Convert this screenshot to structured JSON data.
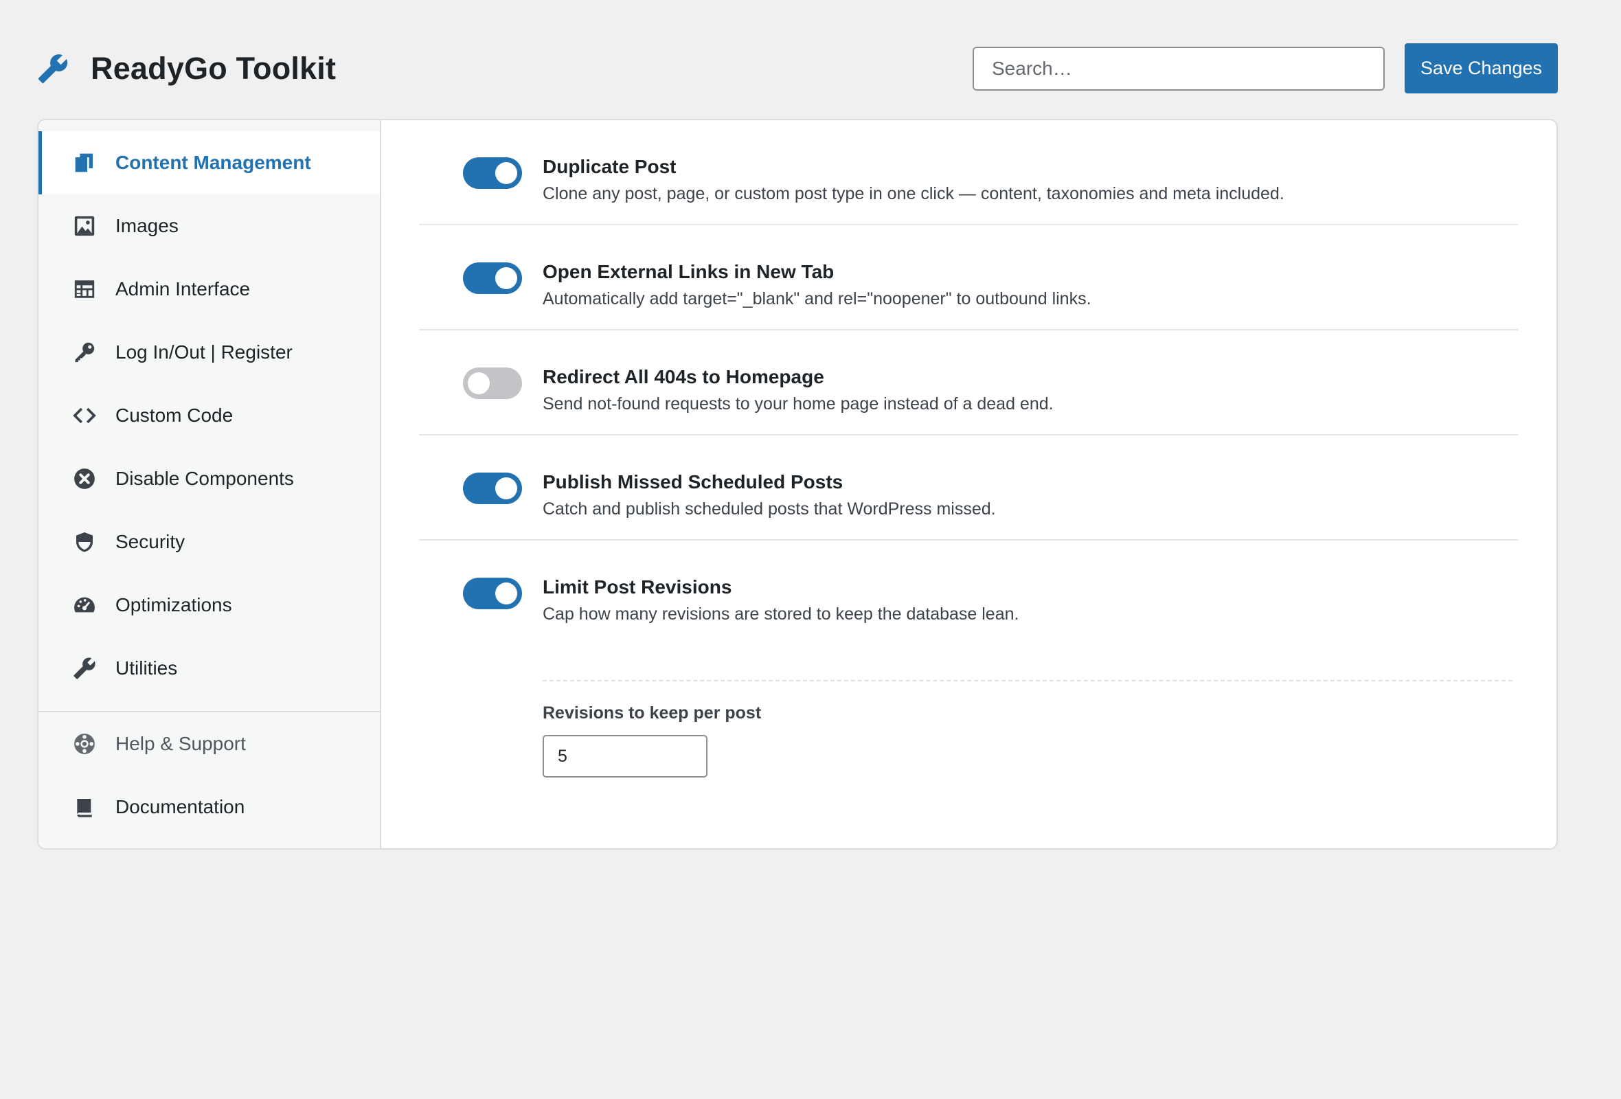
{
  "header": {
    "title": "ReadyGo Toolkit",
    "search_placeholder": "Search…",
    "save_label": "Save Changes"
  },
  "sidebar": {
    "items": [
      {
        "label": "Content Management",
        "icon": "copy-icon",
        "active": true
      },
      {
        "label": "Images",
        "icon": "image-icon"
      },
      {
        "label": "Admin Interface",
        "icon": "table-icon"
      },
      {
        "label": "Log In/Out | Register",
        "icon": "key-icon"
      },
      {
        "label": "Custom Code",
        "icon": "code-icon"
      },
      {
        "label": "Disable Components",
        "icon": "x-circle-icon"
      },
      {
        "label": "Security",
        "icon": "shield-icon"
      },
      {
        "label": "Optimizations",
        "icon": "dashboard-icon"
      },
      {
        "label": "Utilities",
        "icon": "wrench-icon"
      }
    ],
    "secondary": [
      {
        "label": "Help & Support",
        "icon": "lifebuoy-icon"
      },
      {
        "label": "Documentation",
        "icon": "book-icon"
      }
    ]
  },
  "settings": [
    {
      "title": "Duplicate Post",
      "description": "Clone any post, page, or custom post type in one click — content, taxonomies and meta included.",
      "enabled": true
    },
    {
      "title": "Open External Links in New Tab",
      "description": "Automatically add target=\"_blank\" and rel=\"noopener\" to outbound links.",
      "enabled": true
    },
    {
      "title": "Redirect All 404s to Homepage",
      "description": "Send not-found requests to your home page instead of a dead end.",
      "enabled": false
    },
    {
      "title": "Publish Missed Scheduled Posts",
      "description": "Catch and publish scheduled posts that WordPress missed.",
      "enabled": true
    },
    {
      "title": "Limit Post Revisions",
      "description": "Cap how many revisions are stored to keep the database lean.",
      "enabled": true,
      "sub_label": "Revisions to keep per post",
      "sub_value": "5"
    }
  ],
  "colors": {
    "accent": "#2271b1",
    "toggle_off": "#c3c4c7",
    "background": "#f0f0f1"
  }
}
